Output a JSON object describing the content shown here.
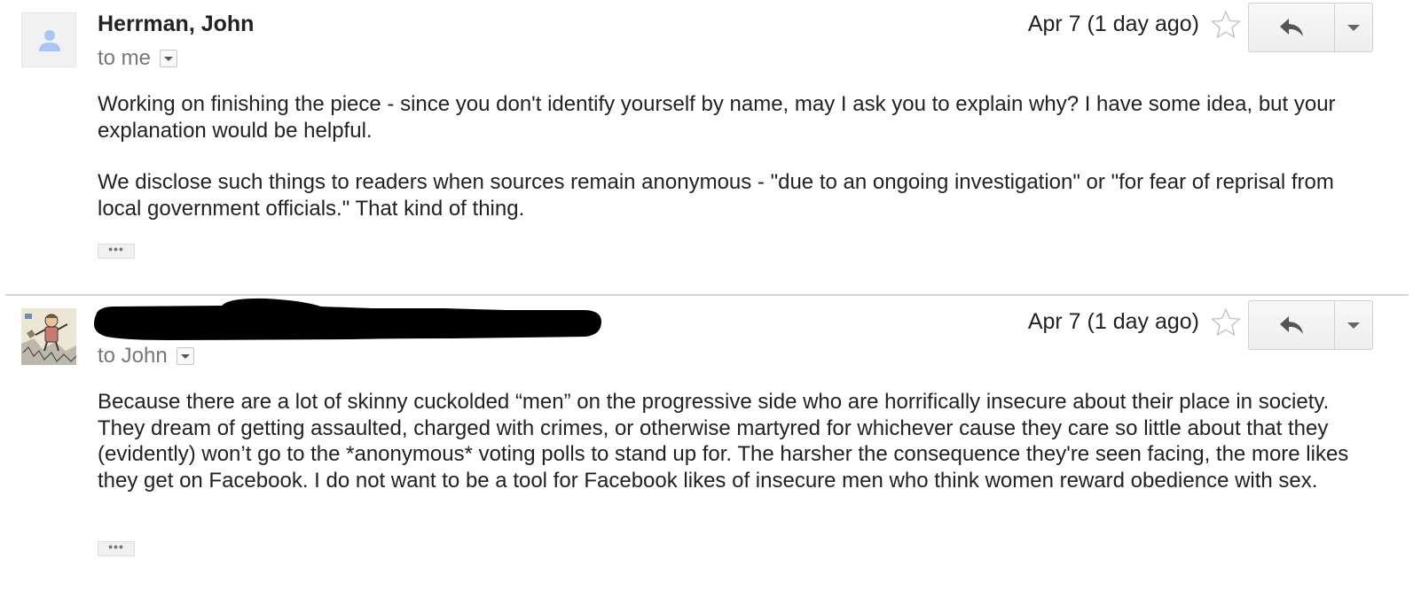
{
  "messages": [
    {
      "sender": "Herrman, John",
      "recipient": "to me",
      "date": "Apr 7 (1 day ago)",
      "paragraphs": [
        "Working on finishing the piece - since you don't identify yourself by name, may I ask you to explain why? I have some idea, but your explanation would be helpful.",
        "We disclose such things to readers when sources remain anonymous - \"due to an ongoing investigation\" or \"for fear of reprisal from local government officials.\" That kind of thing."
      ],
      "trimmed_label": "•••"
    },
    {
      "sender": "",
      "recipient": "to John",
      "date": "Apr 7 (1 day ago)",
      "paragraphs": [
        "Because there are a lot of skinny cuckolded “men” on the progressive side who are horrifically insecure about their place in society. They dream of getting assaulted, charged with crimes, or otherwise martyred for whichever cause they care so little about that they (evidently) won’t go to the *anonymous* voting polls to stand up for. The harsher the consequence they're seen facing, the more likes they get on Facebook. I do not want to be a tool for Facebook likes of insecure men who think women reward obedience with sex."
      ],
      "trimmed_label": "•••"
    }
  ],
  "icons": {
    "avatar_default": "default-person-icon",
    "star": "star-outline-icon",
    "reply": "reply-arrow-icon",
    "more": "dropdown-arrow-icon"
  },
  "colors": {
    "text": "#222222",
    "muted": "#777777",
    "divider": "#d8d8d8",
    "avatar_person": "#a9c5f5",
    "redaction": "#000000"
  }
}
